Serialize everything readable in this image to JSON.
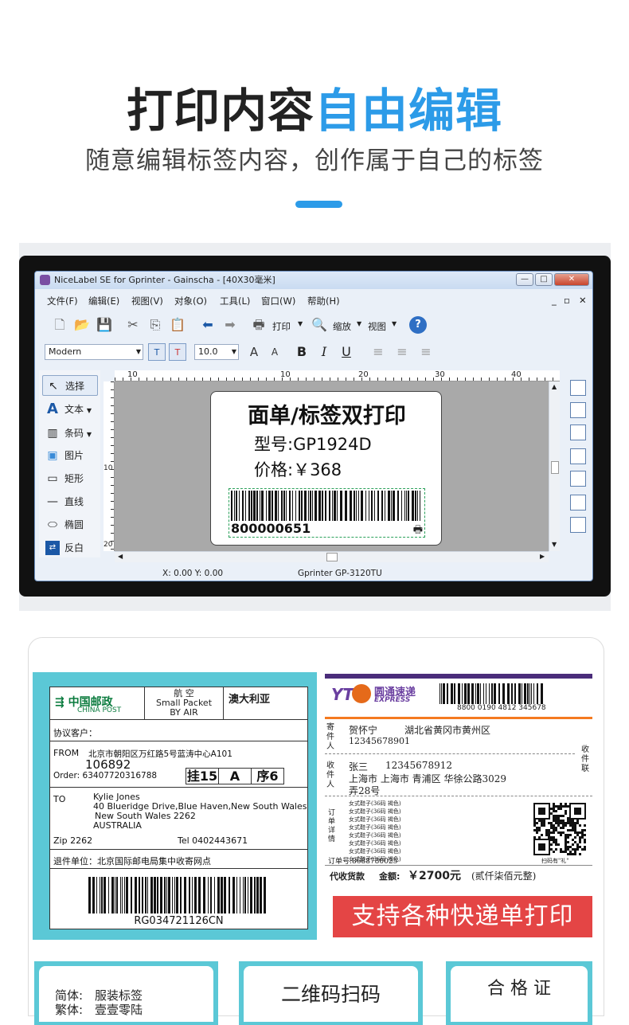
{
  "header": {
    "title_dark": "打印内容",
    "title_blue": "自由编辑",
    "subtitle": "随意编辑标签内容，创作属于自己的标签"
  },
  "colors": {
    "accent": "#2c9be8",
    "banner_red": "#e44545",
    "card_cyan": "#5bc8d6"
  },
  "app": {
    "window_title": "NiceLabel SE for Gprinter - Gainscha - [40X30毫米]",
    "menu": [
      "文件(F)",
      "编辑(E)",
      "视图(V)",
      "对象(O)",
      "工具(L)",
      "窗口(W)",
      "帮助(H)"
    ],
    "toolbar": {
      "print": "打印",
      "zoom": "缩放",
      "view": "视图"
    },
    "font_name": "Modern",
    "font_size": "10.0",
    "tools": [
      {
        "label": "选择",
        "icon": "pointer-icon"
      },
      {
        "label": "文本",
        "icon": "text-icon"
      },
      {
        "label": "条码",
        "icon": "barcode-icon"
      },
      {
        "label": "图片",
        "icon": "picture-icon"
      },
      {
        "label": "矩形",
        "icon": "rectangle-icon"
      },
      {
        "label": "直线",
        "icon": "line-icon"
      },
      {
        "label": "椭圆",
        "icon": "ellipse-icon"
      },
      {
        "label": "反白",
        "icon": "inverse-icon"
      }
    ],
    "ruler_h": [
      "10",
      "10",
      "20",
      "30",
      "40"
    ],
    "ruler_v": [
      "10",
      "20"
    ],
    "status_coords": "X:  0.00 Y:  0.00",
    "status_printer": "Gprinter  GP-3120TU",
    "label": {
      "title": "面单/标签双打印",
      "model": "型号:GP1924D",
      "price": "价格:￥368",
      "barcode_number": "800000651"
    }
  },
  "china_post": {
    "logo_cn": "中国邮政",
    "logo_en": "CHINA POST",
    "airmail_cn": "航 空",
    "airmail_en1": "Small Packet",
    "airmail_en2": "BY AIR",
    "country": "澳大利亚",
    "customer": "协议客户：",
    "from_label": "FROM",
    "from_addr": "北京市朝阳区万红路5号蓝涛中心A101",
    "postcode": "106892",
    "order": "Order: 63407720316788",
    "box1": "挂15",
    "box2": "A",
    "box3": "序6",
    "to_label": "TO",
    "to_name": "Kylie Jones",
    "to_addr1": "40 Blueridge Drive,Blue Haven,New South Wales",
    "to_addr2": "New South Wales  2262",
    "to_addr3": "AUSTRALIA",
    "zip": "Zip  2262",
    "tel": "Tel  0402443671",
    "return": "退件单位：北京国际邮电局集中收寄网点",
    "tracking": "RG034721126CN"
  },
  "yto": {
    "logo": "YT",
    "name_cn": "圆通速递",
    "name_en": "EXPRESS",
    "barcode_no": "8800  0190  4812  345678",
    "sender_label": "寄件人",
    "sender_name": "贺怀宁",
    "sender_addr": "湖北省黄冈市黄州区",
    "sender_phone": "12345678901",
    "receiver_label": "收件人",
    "receiver_name": "张三",
    "receiver_phone": "12345678912",
    "receiver_addr1": "上海市  上海市  青浦区  华徐公路3029",
    "receiver_addr2": "弄28号",
    "stub_label": "收件联",
    "detail_label": "订单详情",
    "items": [
      "女式鞋子(36码 褐色)",
      "女式鞋子(36码 褐色)",
      "女式鞋子(36码 褐色)",
      "女式鞋子(36码 褐色)",
      "女式鞋子(36码 褐色)",
      "女式鞋子(36码 褐色)",
      "女式鞋子(36码 褐色)",
      "女式鞋子(36码 褐色)"
    ],
    "qr_caption": "扫码有\"礼\"",
    "order_no": "订单号:8688780025",
    "cod_label": "代收货款",
    "amount_label": "金额:",
    "amount": "￥2700元",
    "amount_words": "(贰仟柒佰元整)"
  },
  "banner": "支持各种快递单打印",
  "bottom_cards": {
    "card1_line1_label": "简体:",
    "card1_line1_value": "服装标签",
    "card1_line2_label": "繁体:",
    "card1_line2_value": "壹壹零陆",
    "card2_title": "二维码扫码",
    "card3_title": "合  格  证"
  }
}
